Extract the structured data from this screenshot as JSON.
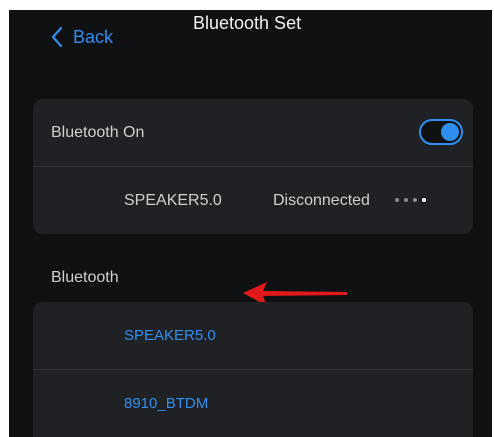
{
  "header": {
    "back_label": "Back",
    "title": "Bluetooth Set"
  },
  "bluetooth_toggle": {
    "label": "Bluetooth On",
    "enabled": true
  },
  "paired_device": {
    "name": "SPEAKER5.0",
    "status": "Disconnected"
  },
  "devices_section": {
    "label": "Bluetooth",
    "items": [
      {
        "name": "SPEAKER5.0"
      },
      {
        "name": "8910_BTDM"
      }
    ]
  },
  "colors": {
    "accent": "#2f8ff0",
    "background": "#0f1012",
    "card": "#202124",
    "annotation_arrow": "#e01a1a"
  },
  "icons": {
    "back": "chevron-left-icon",
    "more": "more-dots-icon",
    "annotation": "arrow-left-icon"
  }
}
